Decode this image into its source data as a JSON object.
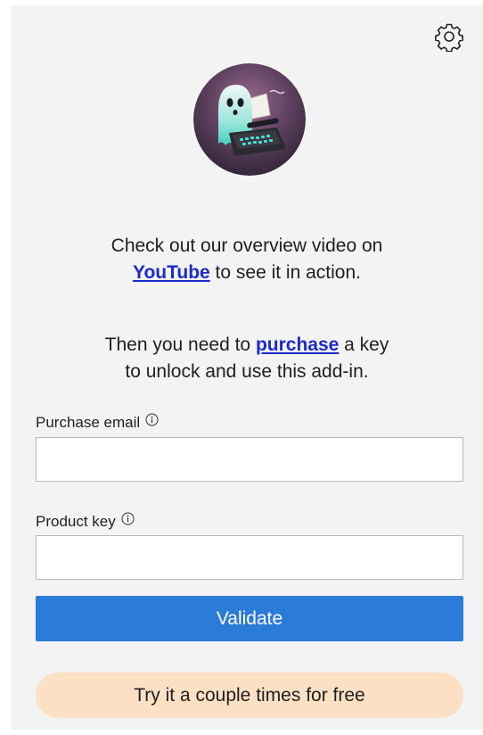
{
  "intro": {
    "line1": "Check out our overview video on",
    "youtube_link": "YouTube",
    "line2_rest": " to see it in action."
  },
  "purchase_msg": {
    "prefix": "Then you need to ",
    "purchase_link": "purchase",
    "suffix": " a key",
    "line2": "to unlock and use this add-in."
  },
  "form": {
    "email_label": "Purchase email",
    "email_value": "",
    "key_label": "Product key",
    "key_value": ""
  },
  "buttons": {
    "validate": "Validate",
    "try_free": "Try it a couple times for free"
  },
  "icons": {
    "settings": "gear-icon",
    "info": "info-icon",
    "avatar": "ghost-typewriter-logo"
  },
  "colors": {
    "primary": "#2b7bd8",
    "try_free_bg": "#fbe0c4",
    "link": "#1d29c9",
    "panel_bg": "#f3f3f3"
  }
}
